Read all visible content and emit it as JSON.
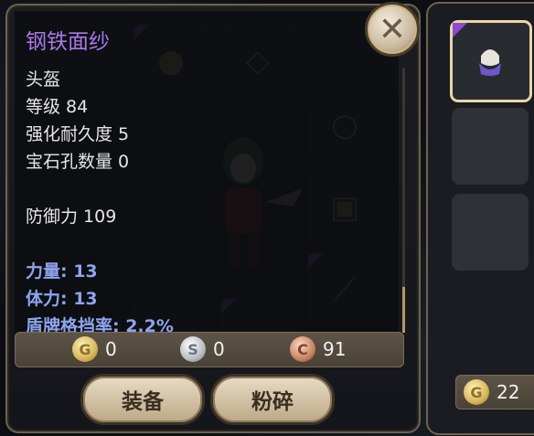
{
  "item": {
    "name": "钢铁面纱",
    "type": "头盔",
    "level": "等级 84",
    "durability": "强化耐久度 5",
    "gem_slots": "宝石孔数量 0",
    "defense": "防御力 109",
    "attributes": [
      "力量: 13",
      "体力: 13",
      "盾牌格挡率: 2.2%"
    ]
  },
  "currency": {
    "gold": "0",
    "silver": "0",
    "copper": "91",
    "gold_symbol": "G",
    "silver_symbol": "S",
    "copper_symbol": "C"
  },
  "buttons": {
    "equip": "装备",
    "shatter": "粉碎"
  },
  "side_panel": {
    "gold": "22"
  },
  "icons": {
    "close": "close-icon"
  },
  "colors": {
    "item_name": "#a979e8",
    "attribute": "#8fa4ee",
    "rarity": "#8e49d0"
  }
}
